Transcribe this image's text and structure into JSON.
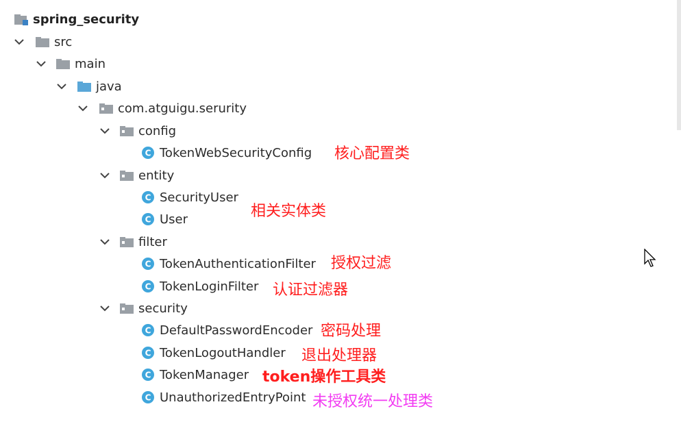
{
  "tree": {
    "root": "spring_security",
    "src": "src",
    "main": "main",
    "java": "java",
    "package": "com.atguigu.serurity",
    "config": {
      "name": "config",
      "classes": [
        "TokenWebSecurityConfig"
      ]
    },
    "entity": {
      "name": "entity",
      "classes": [
        "SecurityUser",
        "User"
      ]
    },
    "filter": {
      "name": "filter",
      "classes": [
        "TokenAuthenticationFilter",
        "TokenLoginFilter"
      ]
    },
    "security": {
      "name": "security",
      "classes": [
        "DefaultPasswordEncoder",
        "TokenLogoutHandler",
        "TokenManager",
        "UnauthorizedEntryPoint"
      ]
    }
  },
  "annotations": {
    "config": "核心配置类",
    "entity": "相关实体类",
    "auth_filter": "授权过滤",
    "login_filter": "认证过滤器",
    "password_encoder": "密码处理",
    "logout_handler": "退出处理器",
    "token_manager": "token操作工具类",
    "entry_point": "未授权统一处理类"
  },
  "colors": {
    "annotation_red": "#ff1e1e",
    "annotation_magenta": "#f23bf2",
    "folder_gray": "#9aa0a6",
    "folder_blue": "#5aa7d8",
    "class_icon": "#3fa6dc"
  },
  "icons": {
    "module": "module-folder-icon",
    "folder": "folder-icon",
    "source_folder": "source-folder-icon",
    "package": "package-icon",
    "class": "class-icon",
    "expanded": "chevron-down-icon"
  }
}
